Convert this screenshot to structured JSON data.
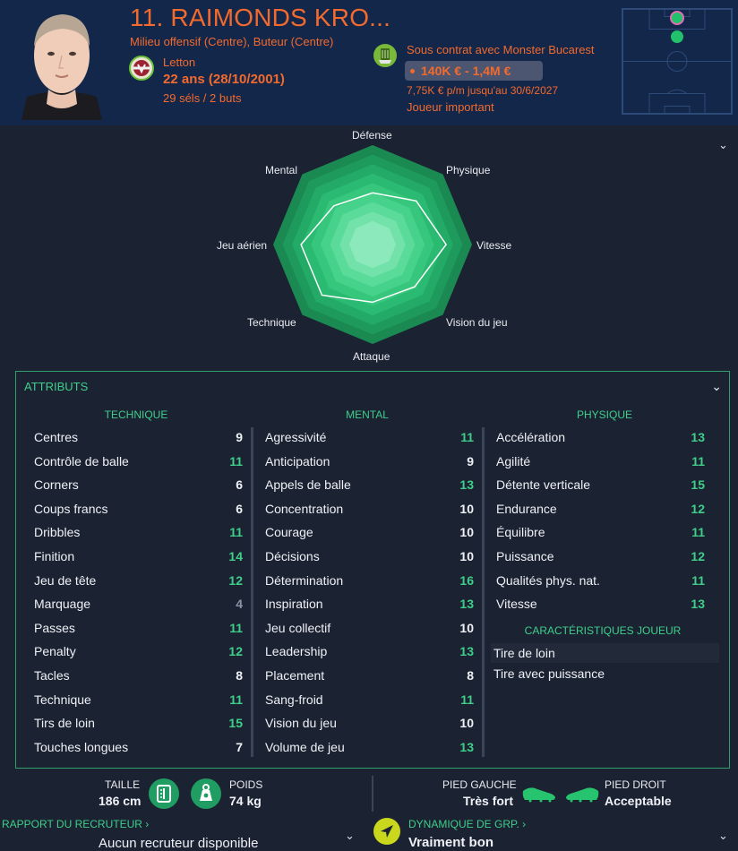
{
  "player": {
    "title": "11. RAIMONDS KRO...",
    "positions": "Milieu offensif (Centre), Buteur (Centre)",
    "nationality": "Letton",
    "age": "22 ans (28/10/2001)",
    "caps": "29 séls / 2 buts"
  },
  "contract": {
    "club_line": "Sous contrat avec Monster Bucarest",
    "value": "140K € - 1,4M €",
    "wage": "7,75K € p/m jusqu'au 30/6/2027",
    "status": "Joueur important"
  },
  "radar": {
    "labels": {
      "defense": "Défense",
      "physique": "Physique",
      "vitesse": "Vitesse",
      "vision": "Vision du jeu",
      "attaque": "Attaque",
      "technique": "Technique",
      "jeu_aerien": "Jeu aérien",
      "mental": "Mental"
    },
    "values": [
      0.52,
      0.62,
      0.74,
      0.6,
      0.58,
      0.72,
      0.72,
      0.55
    ]
  },
  "attributes": {
    "title": "ATTRIBUTS",
    "technique": {
      "heading": "TECHNIQUE",
      "rows": [
        {
          "name": "Centres",
          "value": "9"
        },
        {
          "name": "Contrôle de balle",
          "value": "11"
        },
        {
          "name": "Corners",
          "value": "6"
        },
        {
          "name": "Coups francs",
          "value": "6"
        },
        {
          "name": "Dribbles",
          "value": "11"
        },
        {
          "name": "Finition",
          "value": "14"
        },
        {
          "name": "Jeu de tête",
          "value": "12"
        },
        {
          "name": "Marquage",
          "value": "4"
        },
        {
          "name": "Passes",
          "value": "11"
        },
        {
          "name": "Penalty",
          "value": "12"
        },
        {
          "name": "Tacles",
          "value": "8"
        },
        {
          "name": "Technique",
          "value": "11"
        },
        {
          "name": "Tirs de loin",
          "value": "15"
        },
        {
          "name": "Touches longues",
          "value": "7"
        }
      ]
    },
    "mental": {
      "heading": "MENTAL",
      "rows": [
        {
          "name": "Agressivité",
          "value": "11"
        },
        {
          "name": "Anticipation",
          "value": "9"
        },
        {
          "name": "Appels de balle",
          "value": "13"
        },
        {
          "name": "Concentration",
          "value": "10"
        },
        {
          "name": "Courage",
          "value": "10"
        },
        {
          "name": "Décisions",
          "value": "10"
        },
        {
          "name": "Détermination",
          "value": "16"
        },
        {
          "name": "Inspiration",
          "value": "13"
        },
        {
          "name": "Jeu collectif",
          "value": "10"
        },
        {
          "name": "Leadership",
          "value": "13"
        },
        {
          "name": "Placement",
          "value": "8"
        },
        {
          "name": "Sang-froid",
          "value": "11"
        },
        {
          "name": "Vision du jeu",
          "value": "10"
        },
        {
          "name": "Volume de jeu",
          "value": "13"
        }
      ]
    },
    "physique": {
      "heading": "PHYSIQUE",
      "rows": [
        {
          "name": "Accélération",
          "value": "13"
        },
        {
          "name": "Agilité",
          "value": "11"
        },
        {
          "name": "Détente verticale",
          "value": "15"
        },
        {
          "name": "Endurance",
          "value": "12"
        },
        {
          "name": "Équilibre",
          "value": "11"
        },
        {
          "name": "Puissance",
          "value": "12"
        },
        {
          "name": "Qualités phys. nat.",
          "value": "11"
        },
        {
          "name": "Vitesse",
          "value": "13"
        }
      ]
    },
    "traits": {
      "heading": "CARACTÉRISTIQUES JOUEUR",
      "items": [
        "Tire de loin",
        "Tire avec puissance"
      ]
    }
  },
  "footer": {
    "height_label": "TAILLE",
    "height_value": "186 cm",
    "weight_label": "POIDS",
    "weight_value": "74 kg",
    "left_foot_label": "PIED GAUCHE",
    "left_foot_value": "Très fort",
    "right_foot_label": "PIED DROIT",
    "right_foot_value": "Acceptable",
    "scout_link": "RAPPORT DU RECRUTEUR ›",
    "scout_value": "Aucun recruteur disponible",
    "dynamics_link": "DYNAMIQUE DE GRP. ›",
    "dynamics_value": "Vraiment bon"
  },
  "colors": {
    "accent_orange": "#f26a2e",
    "accent_green": "#3fcf8a",
    "background": "#1b2232",
    "header_bg": "#13274a"
  }
}
